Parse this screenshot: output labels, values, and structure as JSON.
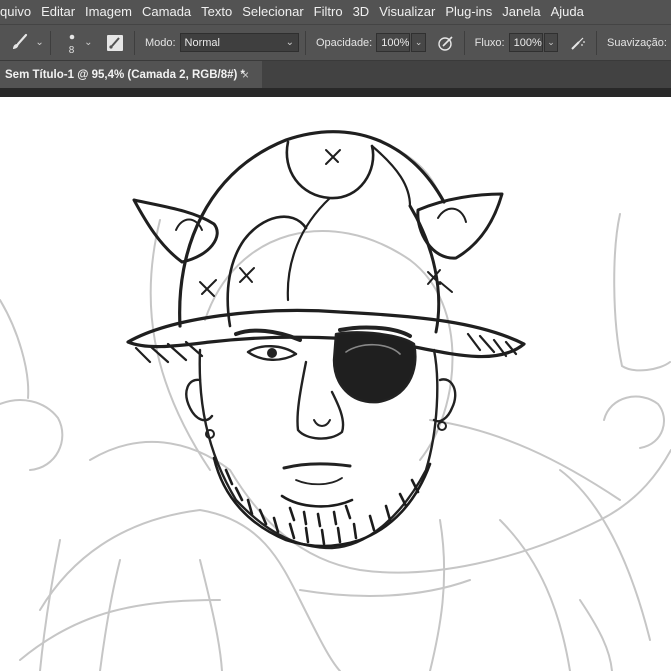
{
  "menu": [
    "quivo",
    "Editar",
    "Imagem",
    "Camada",
    "Texto",
    "Selecionar",
    "Filtro",
    "3D",
    "Visualizar",
    "Plug-ins",
    "Janela",
    "Ajuda"
  ],
  "options": {
    "brush_size": "8",
    "mode_label": "Modo:",
    "mode_value": "Normal",
    "opacity_label": "Opacidade:",
    "opacity_value": "100%",
    "flow_label": "Fluxo:",
    "flow_value": "100%",
    "smoothing_label": "Suavização:"
  },
  "document_tab": {
    "title": "Sem Título-1 @ 95,4% (Camada 2, RGB/8#) *",
    "close": "×"
  },
  "colors": {
    "menu_bg": "#535353",
    "tabbar_bg": "#424242",
    "canvas_bg": "#ffffff",
    "ink": "#1e1e1e",
    "sketch": "#c8c8c8"
  },
  "icons": [
    "brush-icon",
    "brush-size-icon",
    "brush-panel-icon",
    "opacity-pressure-icon",
    "airbrush-icon",
    "chevron-down-icon",
    "close-icon"
  ]
}
